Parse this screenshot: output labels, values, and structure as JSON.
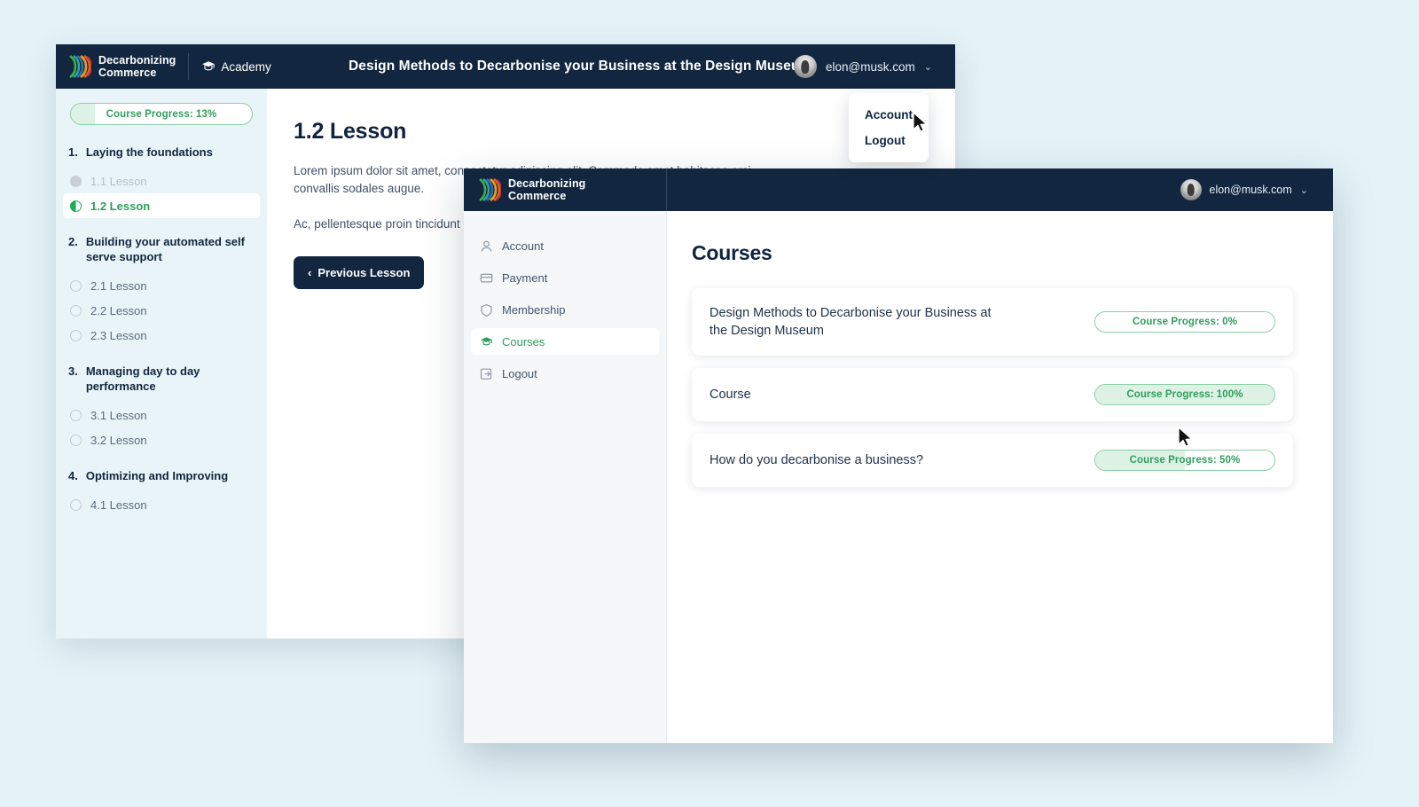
{
  "page": {
    "background_color": "#e4f3f8"
  },
  "brand": {
    "name_line1": "Decarbonizing",
    "name_line2": "Commerce",
    "logo_colors": [
      "#3fae49",
      "#2aa7a0",
      "#2f6fb3",
      "#e8a020",
      "#e0622a",
      "#c8352c"
    ]
  },
  "back_window": {
    "header": {
      "academy_label": "Academy",
      "academy_icon": "graduation-cap-icon",
      "course_title": "Design Methods to Decarbonise your Business at the Design Museum",
      "user_email": "elon@musk.com",
      "caret_icon": "chevron-down-icon"
    },
    "dropdown": {
      "items": [
        {
          "label": "Account"
        },
        {
          "label": "Logout"
        }
      ]
    },
    "sidebar": {
      "progress": {
        "label": "Course Progress: 13%",
        "percent": 13
      },
      "chapters": [
        {
          "num": "1.",
          "title": "Laying the foundations",
          "lessons": [
            {
              "label": "1.1 Lesson",
              "state": "done"
            },
            {
              "label": "1.2 Lesson",
              "state": "active"
            }
          ]
        },
        {
          "num": "2.",
          "title": "Building your automated self serve support",
          "lessons": [
            {
              "label": "2.1 Lesson",
              "state": "todo"
            },
            {
              "label": "2.2 Lesson",
              "state": "todo"
            },
            {
              "label": "2.3 Lesson",
              "state": "todo"
            }
          ]
        },
        {
          "num": "3.",
          "title": "Managing day to day performance",
          "lessons": [
            {
              "label": "3.1 Lesson",
              "state": "todo"
            },
            {
              "label": "3.2 Lesson",
              "state": "todo"
            }
          ]
        },
        {
          "num": "4.",
          "title": "Optimizing and Improving",
          "lessons": [
            {
              "label": "4.1 Lesson",
              "state": "todo"
            }
          ]
        }
      ]
    },
    "main": {
      "heading": "1.2 Lesson",
      "paragraph_1": "Lorem ipsum dolor sit amet, consectetur adipiscing elit. Commodo amet habitasse orci convallis sodales augue.",
      "paragraph_2": "Ac, pellentesque proin tincidunt lobo sagittis elementum placerat nullam i",
      "prev_button": "Previous Lesson",
      "prev_icon": "chevron-left-icon"
    }
  },
  "front_window": {
    "header": {
      "user_email": "elon@musk.com",
      "caret_icon": "chevron-down-icon"
    },
    "sidebar": {
      "items": [
        {
          "label": "Account",
          "icon": "user-icon",
          "active": false
        },
        {
          "label": "Payment",
          "icon": "credit-card-icon",
          "active": false
        },
        {
          "label": "Membership",
          "icon": "shield-icon",
          "active": false
        },
        {
          "label": "Courses",
          "icon": "graduation-cap-icon",
          "active": true
        },
        {
          "label": "Logout",
          "icon": "logout-icon",
          "active": false
        }
      ]
    },
    "main": {
      "heading": "Courses",
      "courses": [
        {
          "title": "Design Methods to Decarbonise your Business at the Design Museum",
          "progress_label": "Course Progress: 0%",
          "percent": 0
        },
        {
          "title": "Course",
          "progress_label": "Course Progress: 100%",
          "percent": 100
        },
        {
          "title": "How do you decarbonise a business?",
          "progress_label": "Course Progress: 50%",
          "percent": 50
        }
      ]
    }
  },
  "theme": {
    "navy": "#12263f",
    "green": "#2f9e5f",
    "green_fill": "#ddf1e4",
    "green_border": "#8ccfa8"
  }
}
